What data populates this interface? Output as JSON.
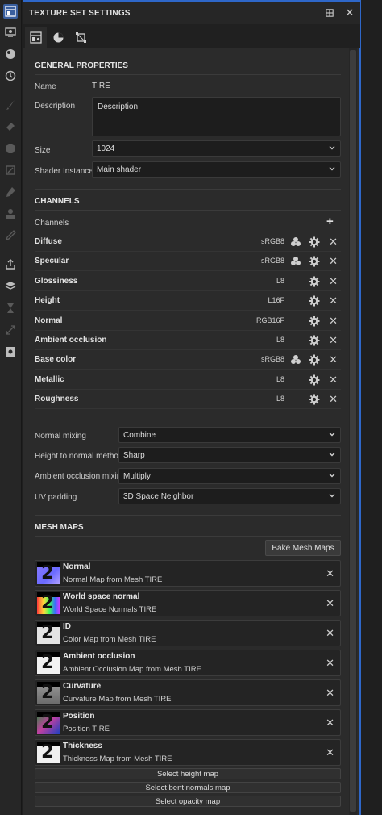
{
  "left_toolbar": {
    "icons": [
      "texture-set-settings-icon",
      "display-icon",
      "shader-icon",
      "history-icon",
      "brush-icon",
      "eraser-icon",
      "projection-icon",
      "polygon-fill-icon",
      "smudge-icon",
      "clone-icon",
      "picker-icon",
      "export-icon",
      "bake-icon",
      "hourglass-icon",
      "transform-icon",
      "screenshot-icon"
    ]
  },
  "panel": {
    "title": "TEXTURE SET SETTINGS",
    "tabs": [
      "settings-tab",
      "material-tab",
      "uv-tab"
    ]
  },
  "general": {
    "title": "GENERAL PROPERTIES",
    "name_label": "Name",
    "name_value": "TIRE",
    "description_label": "Description",
    "description_value": "Description",
    "size_label": "Size",
    "size_value": "1024",
    "shader_label": "Shader Instance",
    "shader_value": "Main shader"
  },
  "channels": {
    "title": "CHANNELS",
    "list_label": "Channels",
    "add_symbol": "+",
    "items": [
      {
        "name": "Diffuse",
        "format": "sRGB8",
        "color_profile": true
      },
      {
        "name": "Specular",
        "format": "sRGB8",
        "color_profile": true
      },
      {
        "name": "Glossiness",
        "format": "L8",
        "color_profile": false
      },
      {
        "name": "Height",
        "format": "L16F",
        "color_profile": false
      },
      {
        "name": "Normal",
        "format": "RGB16F",
        "color_profile": false
      },
      {
        "name": "Ambient occlusion",
        "format": "L8",
        "color_profile": false
      },
      {
        "name": "Base color",
        "format": "sRGB8",
        "color_profile": true
      },
      {
        "name": "Metallic",
        "format": "L8",
        "color_profile": false
      },
      {
        "name": "Roughness",
        "format": "L8",
        "color_profile": false
      }
    ]
  },
  "options": {
    "normal_mixing_label": "Normal mixing",
    "normal_mixing_value": "Combine",
    "height_to_normal_label": "Height to normal method",
    "height_to_normal_value": "Sharp",
    "ao_mixing_label": "Ambient occlusion mixing",
    "ao_mixing_value": "Multiply",
    "uv_padding_label": "UV padding",
    "uv_padding_value": "3D Space Neighbor"
  },
  "mesh_maps": {
    "title": "MESH MAPS",
    "bake_label": "Bake Mesh Maps",
    "items": [
      {
        "name": "Normal",
        "desc": "Normal Map from Mesh TIRE",
        "thumb": "normal",
        "number": "2"
      },
      {
        "name": "World space normal",
        "desc": "World Space Normals TIRE",
        "thumb": "world",
        "number": "2"
      },
      {
        "name": "ID",
        "desc": "Color Map from Mesh TIRE",
        "thumb": "id",
        "number": "2"
      },
      {
        "name": "Ambient occlusion",
        "desc": "Ambient Occlusion Map from Mesh TIRE",
        "thumb": "ao",
        "number": "2"
      },
      {
        "name": "Curvature",
        "desc": "Curvature Map from Mesh TIRE",
        "thumb": "curv",
        "number": "2"
      },
      {
        "name": "Position",
        "desc": "Position TIRE",
        "thumb": "pos",
        "number": "2"
      },
      {
        "name": "Thickness",
        "desc": "Thickness Map from Mesh TIRE",
        "thumb": "thick",
        "number": "2"
      }
    ],
    "select_height": "Select height map",
    "select_bent": "Select bent normals map",
    "select_opacity": "Select opacity map"
  },
  "colors": {
    "accent": "#2e67c9",
    "panel_bg": "#2b2b2b",
    "field_bg": "#1d1d1d"
  }
}
